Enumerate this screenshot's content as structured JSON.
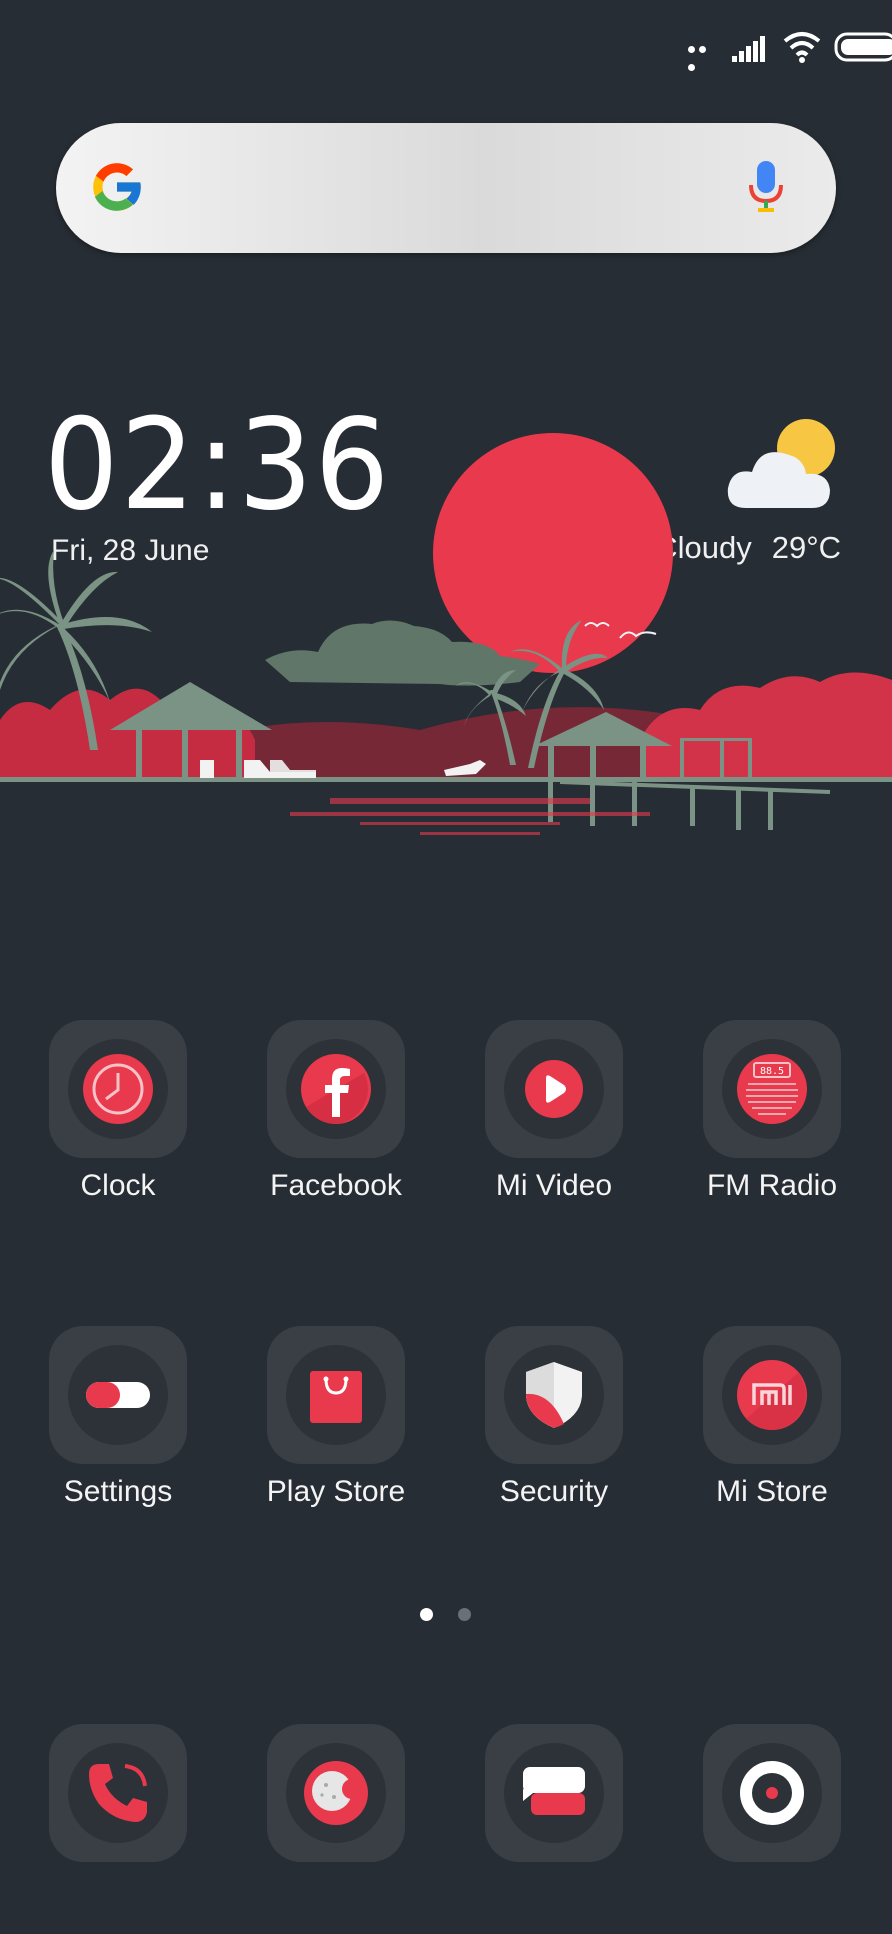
{
  "status_bar": {
    "icons": [
      "more-dots-icon",
      "signal-icon",
      "wifi-icon",
      "battery-icon"
    ]
  },
  "search": {
    "icons": [
      "google-logo",
      "microphone-icon"
    ]
  },
  "clock_widget": {
    "time": "02:36",
    "date": "Fri, 28 June"
  },
  "weather_widget": {
    "condition": "Cloudy",
    "temperature": "29°C",
    "icon": "partly-cloudy-icon"
  },
  "apps_row1": [
    {
      "label": "Clock",
      "icon": "clock-icon"
    },
    {
      "label": "Facebook",
      "icon": "facebook-icon"
    },
    {
      "label": "Mi Video",
      "icon": "play-icon"
    },
    {
      "label": "FM Radio",
      "icon": "radio-icon"
    }
  ],
  "apps_row2": [
    {
      "label": "Settings",
      "icon": "toggle-icon"
    },
    {
      "label": "Play Store",
      "icon": "shopping-bag-icon"
    },
    {
      "label": "Security",
      "icon": "shield-icon"
    },
    {
      "label": "Mi Store",
      "icon": "mi-logo-icon"
    }
  ],
  "pager": {
    "pages": 2,
    "active": 1
  },
  "dock": [
    {
      "icon": "phone-icon"
    },
    {
      "icon": "browser-icon"
    },
    {
      "icon": "messages-icon"
    },
    {
      "icon": "camera-icon"
    }
  ],
  "colors": {
    "background": "#272d34",
    "accent": "#e8394d",
    "tile": "#3a3f45",
    "foliage": "#7a9384"
  }
}
